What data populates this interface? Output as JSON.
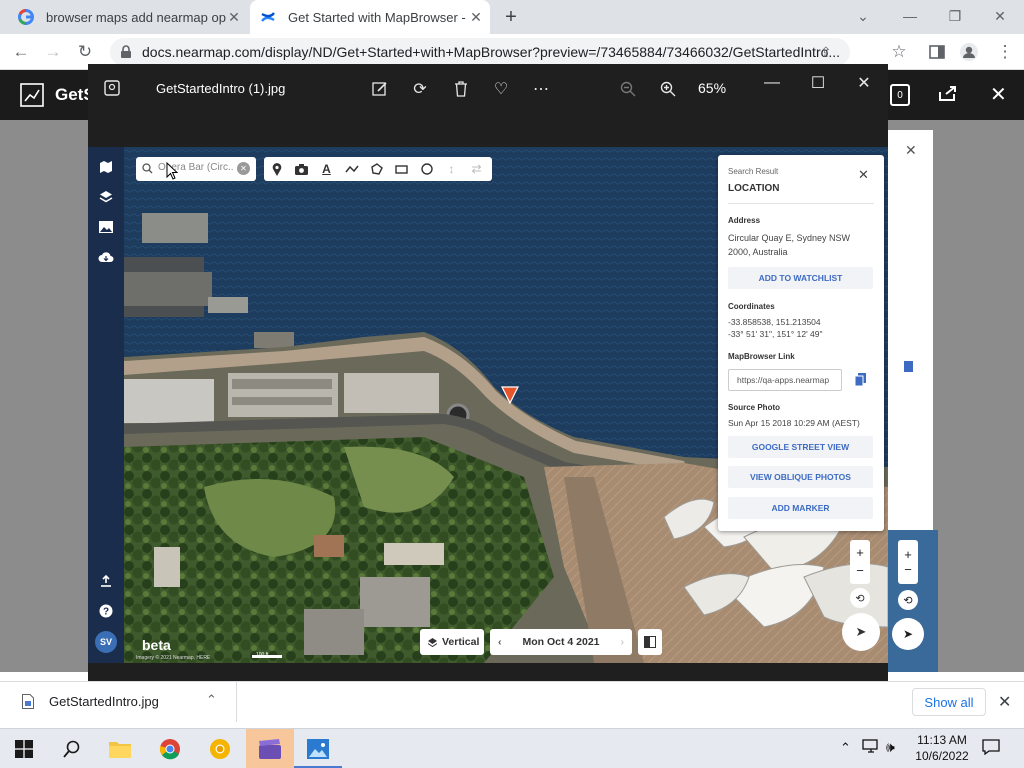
{
  "browser": {
    "tabs": [
      {
        "title": "browser maps add nearmap ope",
        "favicon": "google-icon"
      },
      {
        "title": "Get Started with MapBrowser - P",
        "favicon": "confluence-icon",
        "active": true
      }
    ],
    "url": "docs.nearmap.com/display/ND/Get+Started+with+MapBrowser?preview=/73465884/73466032/GetStartedIntro...",
    "window_controls": [
      "minimize",
      "restore",
      "close"
    ]
  },
  "page_behind": {
    "header_title": "GetS",
    "header_badge": "0"
  },
  "viewer": {
    "title": "GetStartedIntro (1).jpg",
    "zoom_level": "65%",
    "toolbar_icons": [
      "edit-icon",
      "rotate-icon",
      "delete-icon",
      "favorite-icon",
      "more-icon"
    ],
    "zoom_icons": [
      "zoom-out-icon",
      "zoom-in-icon"
    ]
  },
  "map": {
    "search_placeholder": "Opera Bar (Circ...",
    "sidebar_icons": [
      "map-icon",
      "layers-icon",
      "image-icon",
      "cloud-download-icon",
      "export-icon",
      "help-icon"
    ],
    "user_initials": "SV",
    "tools": [
      "marker-icon",
      "camera-icon",
      "text-icon",
      "line-icon",
      "lasso-icon",
      "rectangle-icon",
      "circle-icon",
      "height-icon",
      "measure-icon"
    ],
    "result": {
      "kicker": "Search Result",
      "heading": "LOCATION",
      "address_label": "Address",
      "address": "Circular Quay E, Sydney NSW 2000, Australia",
      "watchlist_btn": "ADD TO WATCHLIST",
      "coords_label": "Coordinates",
      "coords_decimal": "-33.858538, 151.213504",
      "coords_dms": "-33° 51' 31\", 151° 12' 49\"",
      "link_label": "MapBrowser Link",
      "link_value": "https://qa-apps.nearmap",
      "photo_label": "Source Photo",
      "photo_date": "Sun Apr 15 2018 10:29 AM (AEST)",
      "street_view_btn": "GOOGLE STREET VIEW",
      "oblique_btn": "VIEW OBLIQUE PHOTOS",
      "marker_btn": "ADD MARKER"
    },
    "view_mode": "Vertical",
    "date": "Mon Oct 4 2021",
    "beta_label": "beta",
    "copyright": "Imagery © 2021 Nearmap, HERE",
    "scale_label": "100 ft"
  },
  "downloads": {
    "file": "GetStartedIntro.jpg",
    "show_all": "Show all"
  },
  "taskbar": {
    "time": "11:13 AM",
    "date": "10/6/2022",
    "apps": [
      "windows-start-icon",
      "search-icon",
      "file-explorer-icon",
      "chrome-icon",
      "chrome-canary-icon",
      "clapper-icon",
      "photos-icon"
    ]
  },
  "colors": {
    "map_sidebar": "#1b2d4d",
    "accent_blue": "#3d6bc4",
    "marker_orange": "#e8552d",
    "viewer_bg": "#1f1f1f"
  }
}
